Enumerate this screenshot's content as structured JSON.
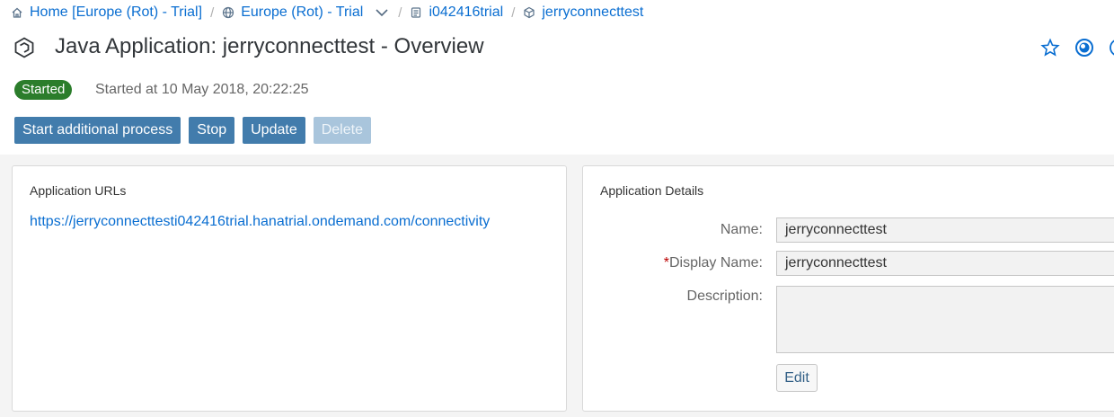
{
  "breadcrumb": {
    "items": [
      {
        "label": "Home [Europe (Rot) - Trial]",
        "icon": "home-icon"
      },
      {
        "label": "Europe (Rot) - Trial",
        "icon": "globe-icon"
      },
      {
        "label": "i042416trial",
        "icon": "subaccount-icon"
      },
      {
        "label": "jerryconnecttest",
        "icon": "application-icon"
      }
    ],
    "separator": "/"
  },
  "header": {
    "title": "Java Application: jerryconnecttest - Overview",
    "icon": "application-icon",
    "actions": [
      "favorite-star-icon",
      "help-icon",
      "info-icon"
    ]
  },
  "status": {
    "badge": "Started",
    "badge_color": "#2b7d2b",
    "text": "Started at 10 May 2018, 20:22:25"
  },
  "toolbar": {
    "start_label": "Start additional process",
    "stop_label": "Stop",
    "update_label": "Update",
    "delete_label": "Delete",
    "accent": "#427cac"
  },
  "urls_panel": {
    "title": "Application URLs",
    "url": "https://jerryconnecttesti042416trial.hanatrial.ondemand.com/connectivity"
  },
  "details_panel": {
    "title": "Application Details",
    "name_label": "Name:",
    "name_value": "jerryconnecttest",
    "display_required_marker": "*",
    "display_label": "Display Name:",
    "display_value": "jerryconnecttest",
    "description_label": "Description:",
    "description_value": "",
    "edit_label": "Edit"
  }
}
